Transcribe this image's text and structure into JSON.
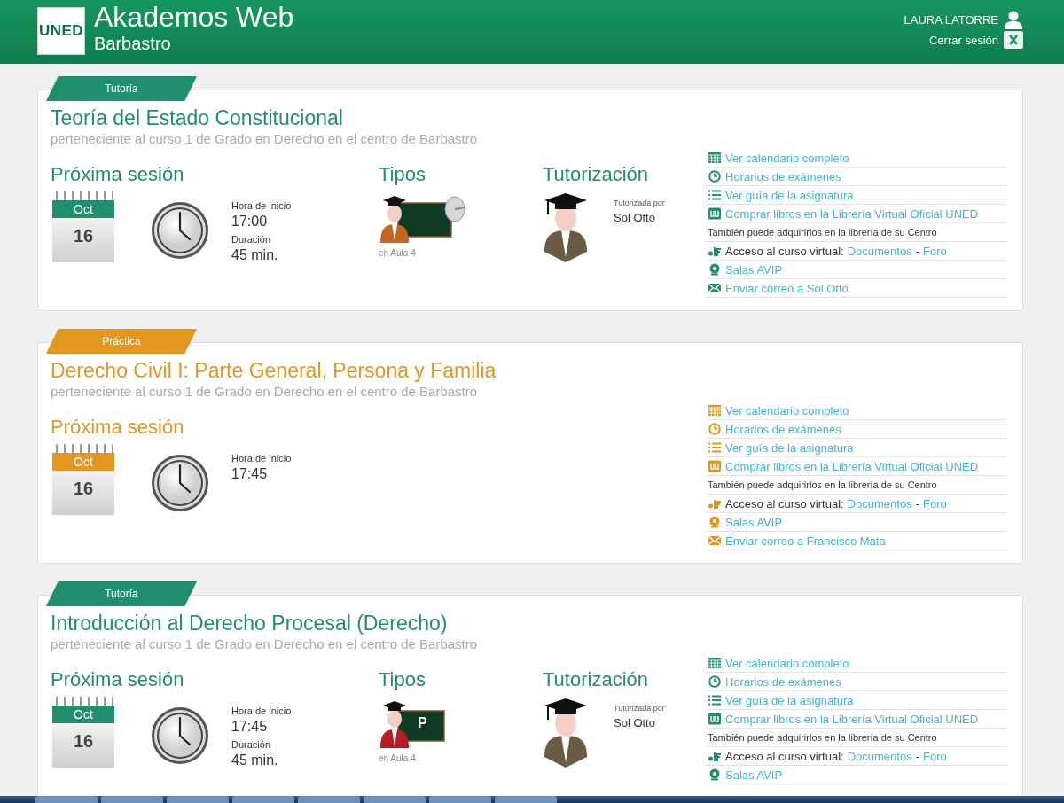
{
  "header": {
    "logo": "UNED",
    "app_title": "Akademos Web",
    "centre": "Barbastro",
    "user_name": "LAURA LATORRE",
    "logout": "Cerrar sesión"
  },
  "cards": [
    {
      "kind": "tutoria",
      "tag": "Tutoría",
      "title": "Teoría del Estado Constitucional",
      "subtitle": "perteneciente al curso 1 de Grado en Derecho en el centro de Barbastro",
      "session": {
        "heading": "Próxima sesión",
        "month": "Oct",
        "day": "16",
        "start_label": "Hora de inicio",
        "start": "17:00",
        "duration_label": "Duración",
        "duration": "45 min."
      },
      "tipos": {
        "heading": "Tipos",
        "kind": "broadcast",
        "room": "en Aula 4"
      },
      "tutor": {
        "heading": "Tutorización",
        "label": "Tutorizada por",
        "name": "Sol Otto"
      },
      "links": [
        {
          "kind": "calendar",
          "text": "Ver calendario completo"
        },
        {
          "kind": "clock",
          "text": "Horarios de exámenes"
        },
        {
          "kind": "list",
          "text": "Ver guía de la asignatura"
        },
        {
          "kind": "book",
          "text": "Comprar libros en la Librería Virtual Oficial UNED"
        },
        {
          "kind": "note",
          "text": "También puede adquirirlos en la librería de su Centro"
        },
        {
          "kind": "alf",
          "text": "Acceso al curso virtual:",
          "link_1": "Documentos",
          "separator": "-",
          "link_2": "Foro"
        },
        {
          "kind": "avip",
          "text": "Salas AVIP"
        },
        {
          "kind": "mail",
          "text": "Enviar correo a Sol Otto"
        }
      ]
    },
    {
      "kind": "practica",
      "tag": "Práctica",
      "title": "Derecho Civil I: Parte General, Persona y Familia",
      "subtitle": "perteneciente al curso 1 de Grado en Derecho en el centro de Barbastro",
      "session": {
        "heading": "Próxima sesión",
        "month": "Oct",
        "day": "16",
        "start_label": "Hora de inicio",
        "start": "17:45"
      },
      "links": [
        {
          "kind": "calendar",
          "text": "Ver calendario completo"
        },
        {
          "kind": "clock",
          "text": "Horarios de exámenes"
        },
        {
          "kind": "list",
          "text": "Ver guía de la asignatura"
        },
        {
          "kind": "book",
          "text": "Comprar libros en la Librería Virtual Oficial UNED"
        },
        {
          "kind": "note",
          "text": "También puede adquirirlos en la librería de su Centro"
        },
        {
          "kind": "alf",
          "text": "Acceso al curso virtual:",
          "link_1": "Documentos",
          "separator": "-",
          "link_2": "Foro"
        },
        {
          "kind": "avip",
          "text": "Salas AVIP"
        },
        {
          "kind": "mail",
          "text": "Enviar correo a Francisco Mata"
        }
      ]
    },
    {
      "kind": "tutoria",
      "tag": "Tutoría",
      "title": "Introducción al Derecho Procesal (Derecho)",
      "subtitle": "perteneciente al curso 1 de Grado en Derecho en el centro de Barbastro",
      "session": {
        "heading": "Próxima sesión",
        "month": "Oct",
        "day": "16",
        "start_label": "Hora de inicio",
        "start": "17:45",
        "duration_label": "Duración",
        "duration": "45 min."
      },
      "tipos": {
        "heading": "Tipos",
        "kind": "classroom",
        "board_text": "P",
        "room": "en Aula 4"
      },
      "tutor": {
        "heading": "Tutorización",
        "label": "Tutorizada por",
        "name": "Sol Otto"
      },
      "links": [
        {
          "kind": "calendar",
          "text": "Ver calendario completo"
        },
        {
          "kind": "clock",
          "text": "Horarios de exámenes"
        },
        {
          "kind": "list",
          "text": "Ver guía de la asignatura"
        },
        {
          "kind": "book",
          "text": "Comprar libros en la Librería Virtual Oficial UNED"
        },
        {
          "kind": "note",
          "text": "También puede adquirirlos en la librería de su Centro"
        },
        {
          "kind": "alf",
          "text": "Acceso al curso virtual:",
          "link_1": "Documentos",
          "separator": "-",
          "link_2": "Foro"
        },
        {
          "kind": "avip",
          "text": "Salas AVIP"
        }
      ]
    }
  ]
}
